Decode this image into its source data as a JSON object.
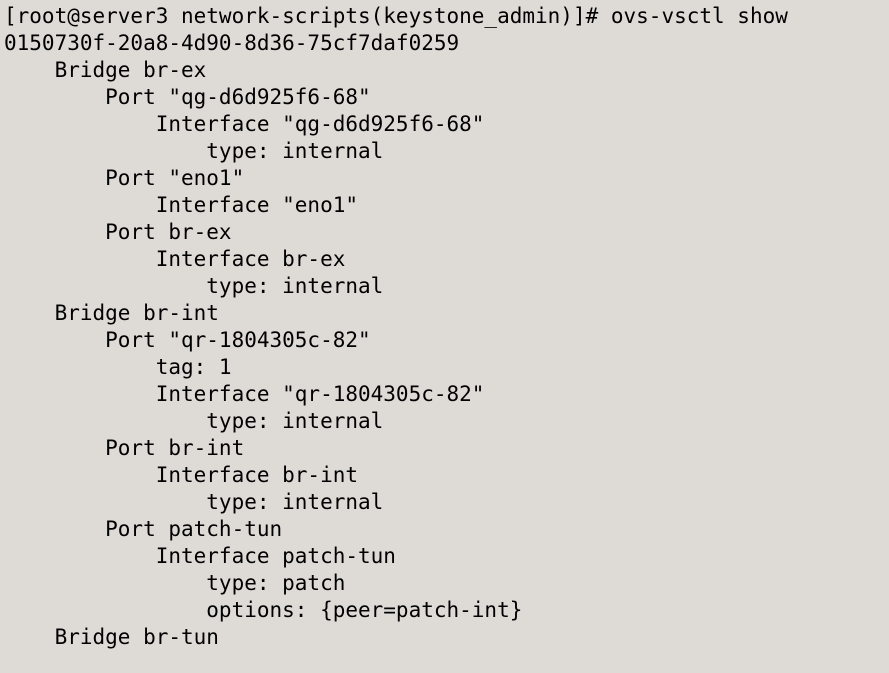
{
  "prompt": "[root@server3 network-scripts(keystone_admin)]# ",
  "command": "ovs-vsctl show",
  "uuid": "0150730f-20a8-4d90-8d36-75cf7daf0259",
  "bridges": [
    {
      "name": "br-ex",
      "ports": [
        {
          "name": "\"qg-d6d925f6-68\"",
          "interface": {
            "name": "\"qg-d6d925f6-68\"",
            "type": "internal"
          }
        },
        {
          "name": "\"eno1\"",
          "interface": {
            "name": "\"eno1\""
          }
        },
        {
          "name": "br-ex",
          "interface": {
            "name": "br-ex",
            "type": "internal"
          }
        }
      ]
    },
    {
      "name": "br-int",
      "ports": [
        {
          "name": "\"qr-1804305c-82\"",
          "tag": "1",
          "interface": {
            "name": "\"qr-1804305c-82\"",
            "type": "internal"
          }
        },
        {
          "name": "br-int",
          "interface": {
            "name": "br-int",
            "type": "internal"
          }
        },
        {
          "name": "patch-tun",
          "interface": {
            "name": "patch-tun",
            "type": "patch",
            "options": "{peer=patch-int}"
          }
        }
      ]
    },
    {
      "name": "br-tun",
      "ports": []
    }
  ],
  "labels": {
    "bridge": "Bridge",
    "port": "Port",
    "interface": "Interface",
    "tag": "tag:",
    "type": "type:",
    "options": "options:"
  },
  "indent": {
    "bridge": "    ",
    "port": "        ",
    "iface": "            ",
    "attr": "                "
  }
}
